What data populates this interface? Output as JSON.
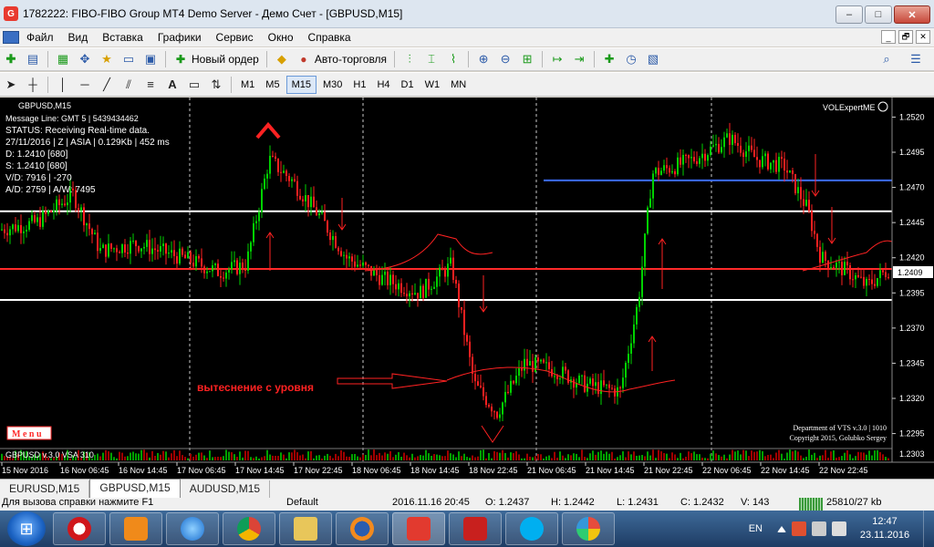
{
  "window": {
    "title": "1782222: FIBO-FIBO Group MT4 Demo Server - Демо Счет - [GBPUSD,M15]",
    "icon": "fibo-logo-icon",
    "buttons": {
      "minimize": "–",
      "maximize": "□",
      "close": "✕"
    }
  },
  "menu": {
    "items": [
      "Файл",
      "Вид",
      "Вставка",
      "Графики",
      "Сервис",
      "Окно",
      "Справка"
    ],
    "mdi_buttons": [
      "_",
      "🗗",
      "✕"
    ]
  },
  "toolbar1": {
    "new_order_label": "Новый ордер",
    "autotrading_label": "Авто-торговля"
  },
  "toolbar2": {
    "timeframes": [
      "M1",
      "M5",
      "M15",
      "M30",
      "H1",
      "H4",
      "D1",
      "W1",
      "MN"
    ],
    "active_timeframe": "M15",
    "text_tool": "A"
  },
  "chart": {
    "symbol_label": "GBPUSD,M15",
    "info_lines": [
      "Message Line: GMT 5 | 5439434462",
      "STATUS:  Receiving Real-time data.",
      "27/11/2016 | Z | ASIA | 0.129Kb | 452 ms",
      "D: 1.2410  [680]",
      "S: 1.2410  [680]",
      "V/D: 7916 | -270",
      "A/D: 2759 | A/W: 7495"
    ],
    "indicator_name": "VOLExpertME",
    "annotation": "вытеснение с уровня",
    "menu_label": "M e n u",
    "credit_lines": [
      "Department of VTS  v.3.0 | 1010",
      "Copyright 2015, Golubko Sergey"
    ],
    "sub_window_label": "GBPUSD v.3.0 VSA 310",
    "price_ticks": [
      "1.2520",
      "1.2495",
      "1.2470",
      "1.2445",
      "1.2420",
      "1.2395",
      "1.2370",
      "1.2345",
      "1.2320",
      "1.2295"
    ],
    "current_price": "1.2409",
    "sub_price": "1.2303",
    "time_labels": [
      "15 Nov 2016",
      "16 Nov 06:45",
      "16 Nov 14:45",
      "17 Nov 06:45",
      "17 Nov 14:45",
      "17 Nov 22:45",
      "18 Nov 06:45",
      "18 Nov 14:45",
      "18 Nov 22:45",
      "21 Nov 06:45",
      "21 Nov 14:45",
      "21 Nov 22:45",
      "22 Nov 06:45",
      "22 Nov 14:45",
      "22 Nov 22:45"
    ],
    "price_min": 1.2285,
    "price_max": 1.253,
    "levels": [
      {
        "price": 1.2475,
        "color": "#3c6cff"
      },
      {
        "price": 1.2453,
        "color": "#ffffff"
      },
      {
        "price": 1.2412,
        "color": "#ff2a2a"
      },
      {
        "price": 1.239,
        "color": "#ffffff"
      }
    ],
    "colors": {
      "bull": "#00d200",
      "bear": "#ff2020",
      "bg": "#000000",
      "text": "#ffffff",
      "annotation": "#ff2222"
    }
  },
  "tabs": {
    "items": [
      "EURUSD,M15",
      "GBPUSD,M15",
      "AUDUSD,M15"
    ],
    "active": "GBPUSD,M15"
  },
  "status": {
    "help": "Для вызова справки нажмите F1",
    "profile": "Default",
    "datetime": "2016.11.16 20:45",
    "open": "O: 1.2437",
    "high": "H: 1.2442",
    "low": "L: 1.2431",
    "close": "C: 1.2432",
    "volume": "V: 143",
    "traffic": "25810/27 kb"
  },
  "taskbar": {
    "lang": "EN",
    "time": "12:47",
    "date": "23.11.2016"
  }
}
